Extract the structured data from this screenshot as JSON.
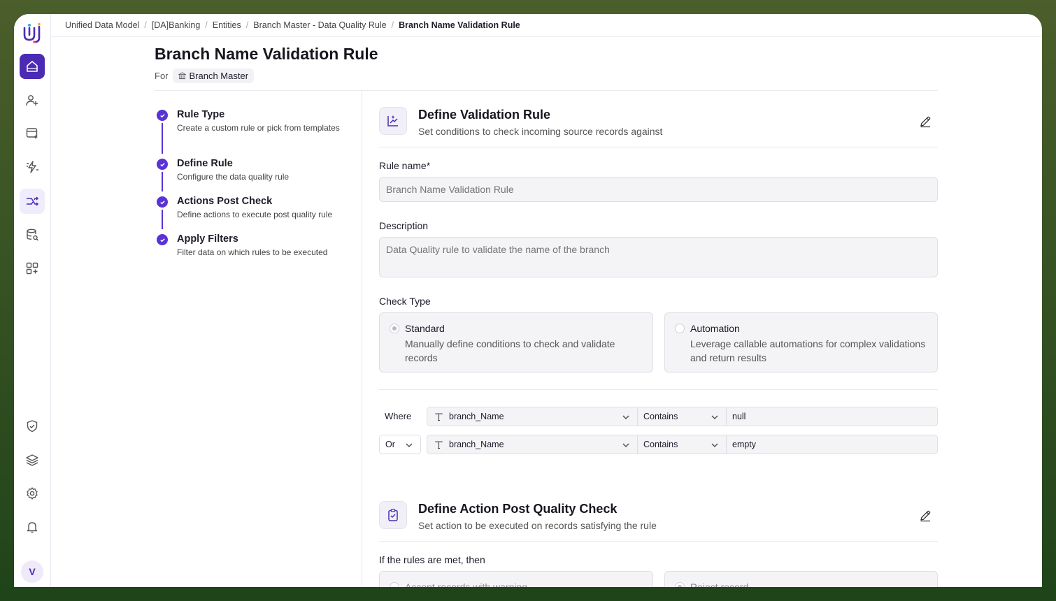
{
  "breadcrumb": {
    "items": [
      "Unified Data Model",
      "[DA]Banking",
      "Entities",
      "Branch Master - Data Quality Rule"
    ],
    "current": "Branch Name Validation Rule",
    "separator": "/"
  },
  "header": {
    "title": "Branch Name Validation Rule",
    "for_label": "For",
    "entity": "Branch Master"
  },
  "rail": {
    "icons": [
      "logo-icon",
      "home-icon",
      "users-icon",
      "sparkle-table-icon",
      "zap-icon",
      "transform-icon",
      "database-search-icon",
      "grid-add-icon",
      "shield-icon",
      "layers-icon",
      "settings-icon",
      "bell-icon"
    ],
    "avatar": "V"
  },
  "steps": [
    {
      "title": "Rule Type",
      "desc": "Create a custom rule or pick from templates"
    },
    {
      "title": "Define Rule",
      "desc": "Configure the data quality rule"
    },
    {
      "title": "Actions Post Check",
      "desc": "Define actions to execute post quality rule"
    },
    {
      "title": "Apply Filters",
      "desc": "Filter data on which rules to be executed"
    }
  ],
  "define_rule": {
    "title": "Define Validation Rule",
    "subtitle": "Set conditions to check incoming source records against",
    "rule_name_label": "Rule name*",
    "rule_name_value": "Branch Name Validation Rule",
    "description_label": "Description",
    "description_value": "Data Quality rule to validate the name of the branch",
    "check_type_label": "Check Type",
    "options": [
      {
        "title": "Standard",
        "desc": "Manually define conditions to check and validate records",
        "selected": true
      },
      {
        "title": "Automation",
        "desc": "Leverage callable automations for complex validations and return results",
        "selected": false
      }
    ],
    "conditions": [
      {
        "connector": "Where",
        "field": "branch_Name",
        "operator": "Contains",
        "value": "null"
      },
      {
        "connector": "Or",
        "field": "branch_Name",
        "operator": "Contains",
        "value": "empty"
      }
    ]
  },
  "action_section": {
    "title": "Define Action Post Quality Check",
    "subtitle": "Set action to be executed on records satisfying the rule",
    "rules_met_label": "If the rules are met, then",
    "options": [
      "Accept records with warning",
      "Reject record"
    ]
  },
  "colors": {
    "accent": "#5b32d6",
    "home_bg": "#4b2bb3",
    "frame_bg": "#4b5e2b"
  }
}
